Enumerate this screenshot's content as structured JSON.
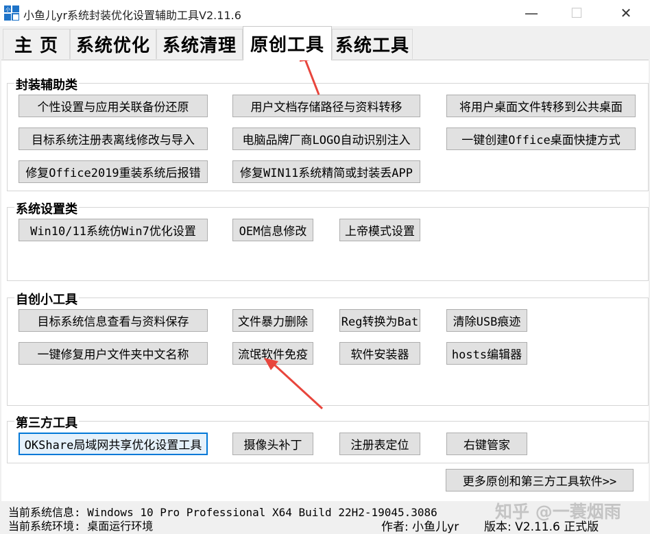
{
  "window": {
    "title": "小鱼儿yr系统封装优化设置辅助工具V2.11.6",
    "icon": "app-logo-icon",
    "controls": {
      "minimize": "—",
      "maximize": "☐",
      "close": "✕"
    }
  },
  "tabs": [
    {
      "label": "主 页",
      "active": false
    },
    {
      "label": "系统优化",
      "active": false
    },
    {
      "label": "系统清理",
      "active": false
    },
    {
      "label": "原创工具",
      "active": true
    },
    {
      "label": "系统工具",
      "active": false
    }
  ],
  "groups": {
    "packaging": {
      "title": "封装辅助类",
      "buttons": [
        "个性设置与应用关联备份还原",
        "用户文档存储路径与资料转移",
        "将用户桌面文件转移到公共桌面",
        "目标系统注册表离线修改与导入",
        "电脑品牌厂商LOGO自动识别注入",
        "一键创建Office桌面快捷方式",
        "修复Office2019重装系统后报错",
        "修复WIN11系统精简或封装丢APP"
      ]
    },
    "settings": {
      "title": "系统设置类",
      "buttons": [
        "Win10/11系统仿Win7优化设置",
        "OEM信息修改",
        "上帝模式设置"
      ]
    },
    "tools": {
      "title": "自创小工具",
      "buttons": [
        "目标系统信息查看与资料保存",
        "文件暴力删除",
        "Reg转换为Bat",
        "清除USB痕迹",
        "一键修复用户文件夹中文名称",
        "流氓软件免疫",
        "软件安装器",
        "hosts编辑器"
      ]
    },
    "third": {
      "title": "第三方工具",
      "buttons": [
        "OKShare局域网共享优化设置工具",
        "摄像头补丁",
        "注册表定位",
        "右键管家"
      ]
    }
  },
  "more_button": "更多原创和第三方工具软件>>",
  "status": {
    "line1": "当前系统信息: Windows 10 Pro Professional X64 Build 22H2-19045.3086",
    "line2": "当前系统环境: 桌面运行环境",
    "author": "作者: 小鱼儿yr",
    "version": "版本: V2.11.6 正式版"
  },
  "watermark": "知乎 @一蓑烟雨",
  "colors": {
    "annotation_arrow": "#e8453c",
    "focus_border": "#0078d7"
  }
}
